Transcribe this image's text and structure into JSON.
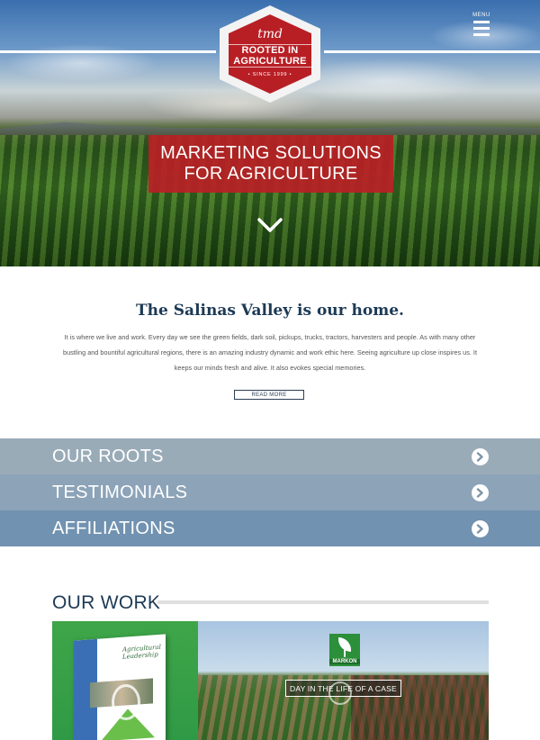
{
  "header": {
    "badge": {
      "logo_text": "tmd",
      "title": "ROOTED IN AGRICULTURE",
      "since": "• SINCE 1999 •",
      "color": "#b81f25"
    },
    "menu_label": "MENU",
    "menu_icon": "hamburger-icon"
  },
  "hero": {
    "banner_line1": "MARKETING SOLUTIONS",
    "banner_line2": "FOR AGRICULTURE",
    "scroll_icon": "chevron-down-icon"
  },
  "intro": {
    "title": "The Salinas Valley is our home.",
    "body": "It is where we live and work. Every day we see the green fields, dark soil, pickups, trucks, tractors, harvesters and people. As with many other bustling and bountiful agricultural regions, there is an amazing industry dynamic and work ethic here. Seeing agriculture up close inspires us. It keeps our minds fresh and alive. It also evokes special memories.",
    "read_more": "READ MORE"
  },
  "accordion": [
    {
      "label": "OUR ROOTS",
      "icon": "arrow-right-circle-icon"
    },
    {
      "label": "TESTIMONIALS",
      "icon": "arrow-right-circle-icon"
    },
    {
      "label": "AFFILIATIONS",
      "icon": "arrow-right-circle-icon"
    }
  ],
  "work": {
    "title": "OUR WORK",
    "tiles": [
      {
        "book_title": "Agricultural Leadership"
      },
      {
        "logo_label": "MARKON",
        "caption": "DAY IN THE LIFE OF A CASE"
      }
    ]
  }
}
